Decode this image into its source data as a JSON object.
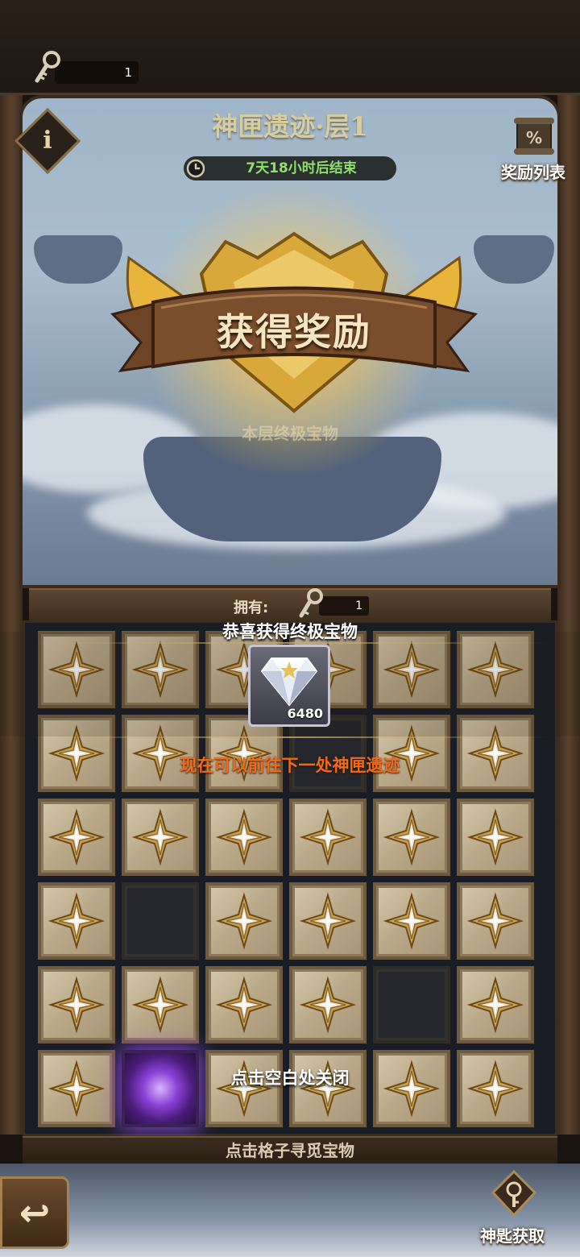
{
  "header": {
    "key_count": "1",
    "key_icon": "key-icon"
  },
  "scene": {
    "title": "神匣遗迹·层1",
    "timer_text": "7天18小时后结束",
    "timer_icon": "clock-icon",
    "info_label": "i",
    "reward_list_label": "奖励列表",
    "reward_list_icon": "scroll-icon",
    "faded_subtitle": "本层终极宝物"
  },
  "reward_popup": {
    "banner": "获得奖励",
    "congrats": "恭喜获得终极宝物",
    "treasure_icon": "diamond-icon",
    "treasure_amount": "6480",
    "next_message": "现在可以前往下一处神匣遗迹",
    "close_hint": "点击空白处关闭"
  },
  "owned": {
    "label": "拥有:",
    "count": "1"
  },
  "grid": {
    "rows": [
      [
        "closed",
        "closed",
        "closed",
        "closed",
        "closed",
        "closed"
      ],
      [
        "closed",
        "closed",
        "closed",
        "opened",
        "closed",
        "closed"
      ],
      [
        "closed",
        "closed",
        "closed",
        "closed",
        "closed",
        "closed"
      ],
      [
        "closed",
        "opened",
        "closed",
        "closed",
        "closed",
        "closed"
      ],
      [
        "closed",
        "closed",
        "closed",
        "closed",
        "opened",
        "closed"
      ],
      [
        "closed",
        "portal",
        "closed",
        "closed",
        "closed",
        "closed"
      ]
    ]
  },
  "footer": {
    "hint": "点击格子寻觅宝物",
    "back_icon": "back-arrow-icon",
    "back_glyph": "↩",
    "key_get_label": "神匙获取",
    "key_get_icon": "key-chest-icon"
  },
  "colors": {
    "timer_text": "#8ee06a",
    "next_message": "#f06a1a",
    "portal": "#8a3fd6"
  }
}
